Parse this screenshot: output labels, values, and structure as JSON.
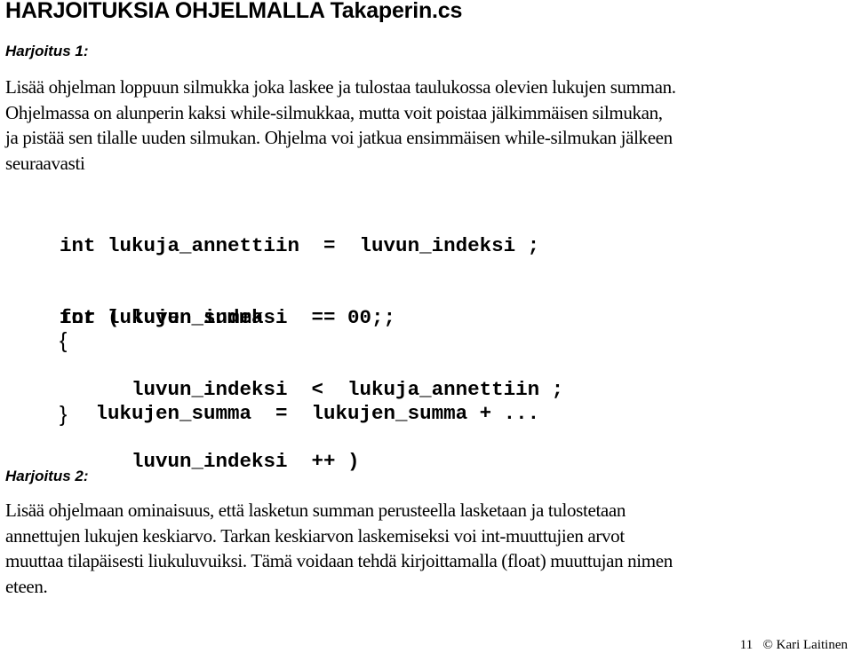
{
  "title": "HARJOITUKSIA OHJELMALLA Takaperin.cs",
  "exercise1": {
    "heading": "Harjoitus 1:",
    "lines": [
      "Lisää ohjelman loppuun silmukka joka laskee ja tulostaa taulukossa olevien lukujen summan.",
      "Ohjelmassa on alunperin kaksi while-silmukkaa, mutta voit poistaa jälkimmäisen silmukan,",
      "ja pistää sen tilalle uuden silmukan. Ohjelma voi jatkua ensimmäisen while-silmukan jälkeen",
      "seuraavasti"
    ],
    "code_decl": [
      "int lukuja_annettiin  =  luvun_indeksi ;",
      "int lukujen_summa     =  0 ;"
    ],
    "code_for": [
      "for ( luvun_indeksi  =  0 ;",
      "      luvun_indeksi  <  lukuja_annettiin ;",
      "      luvun_indeksi  ++ )"
    ],
    "open_brace": "{",
    "code_body": "   lukujen_summa  =  lukujen_summa + ...",
    "close_brace": "}"
  },
  "exercise2": {
    "heading": "Harjoitus 2:",
    "lines": [
      "Lisää ohjelmaan ominaisuus, että lasketun summan perusteella lasketaan ja tulostetaan",
      "annettujen lukujen keskiarvo. Tarkan keskiarvon laskemiseksi voi int-muuttujien arvot",
      "muuttaa tilapäisesti liukuluvuiksi. Tämä voidaan tehdä kirjoittamalla (float) muuttujan nimen",
      "eteen."
    ]
  },
  "footer": {
    "page_number": "11",
    "copyright": "© Kari Laitinen"
  }
}
